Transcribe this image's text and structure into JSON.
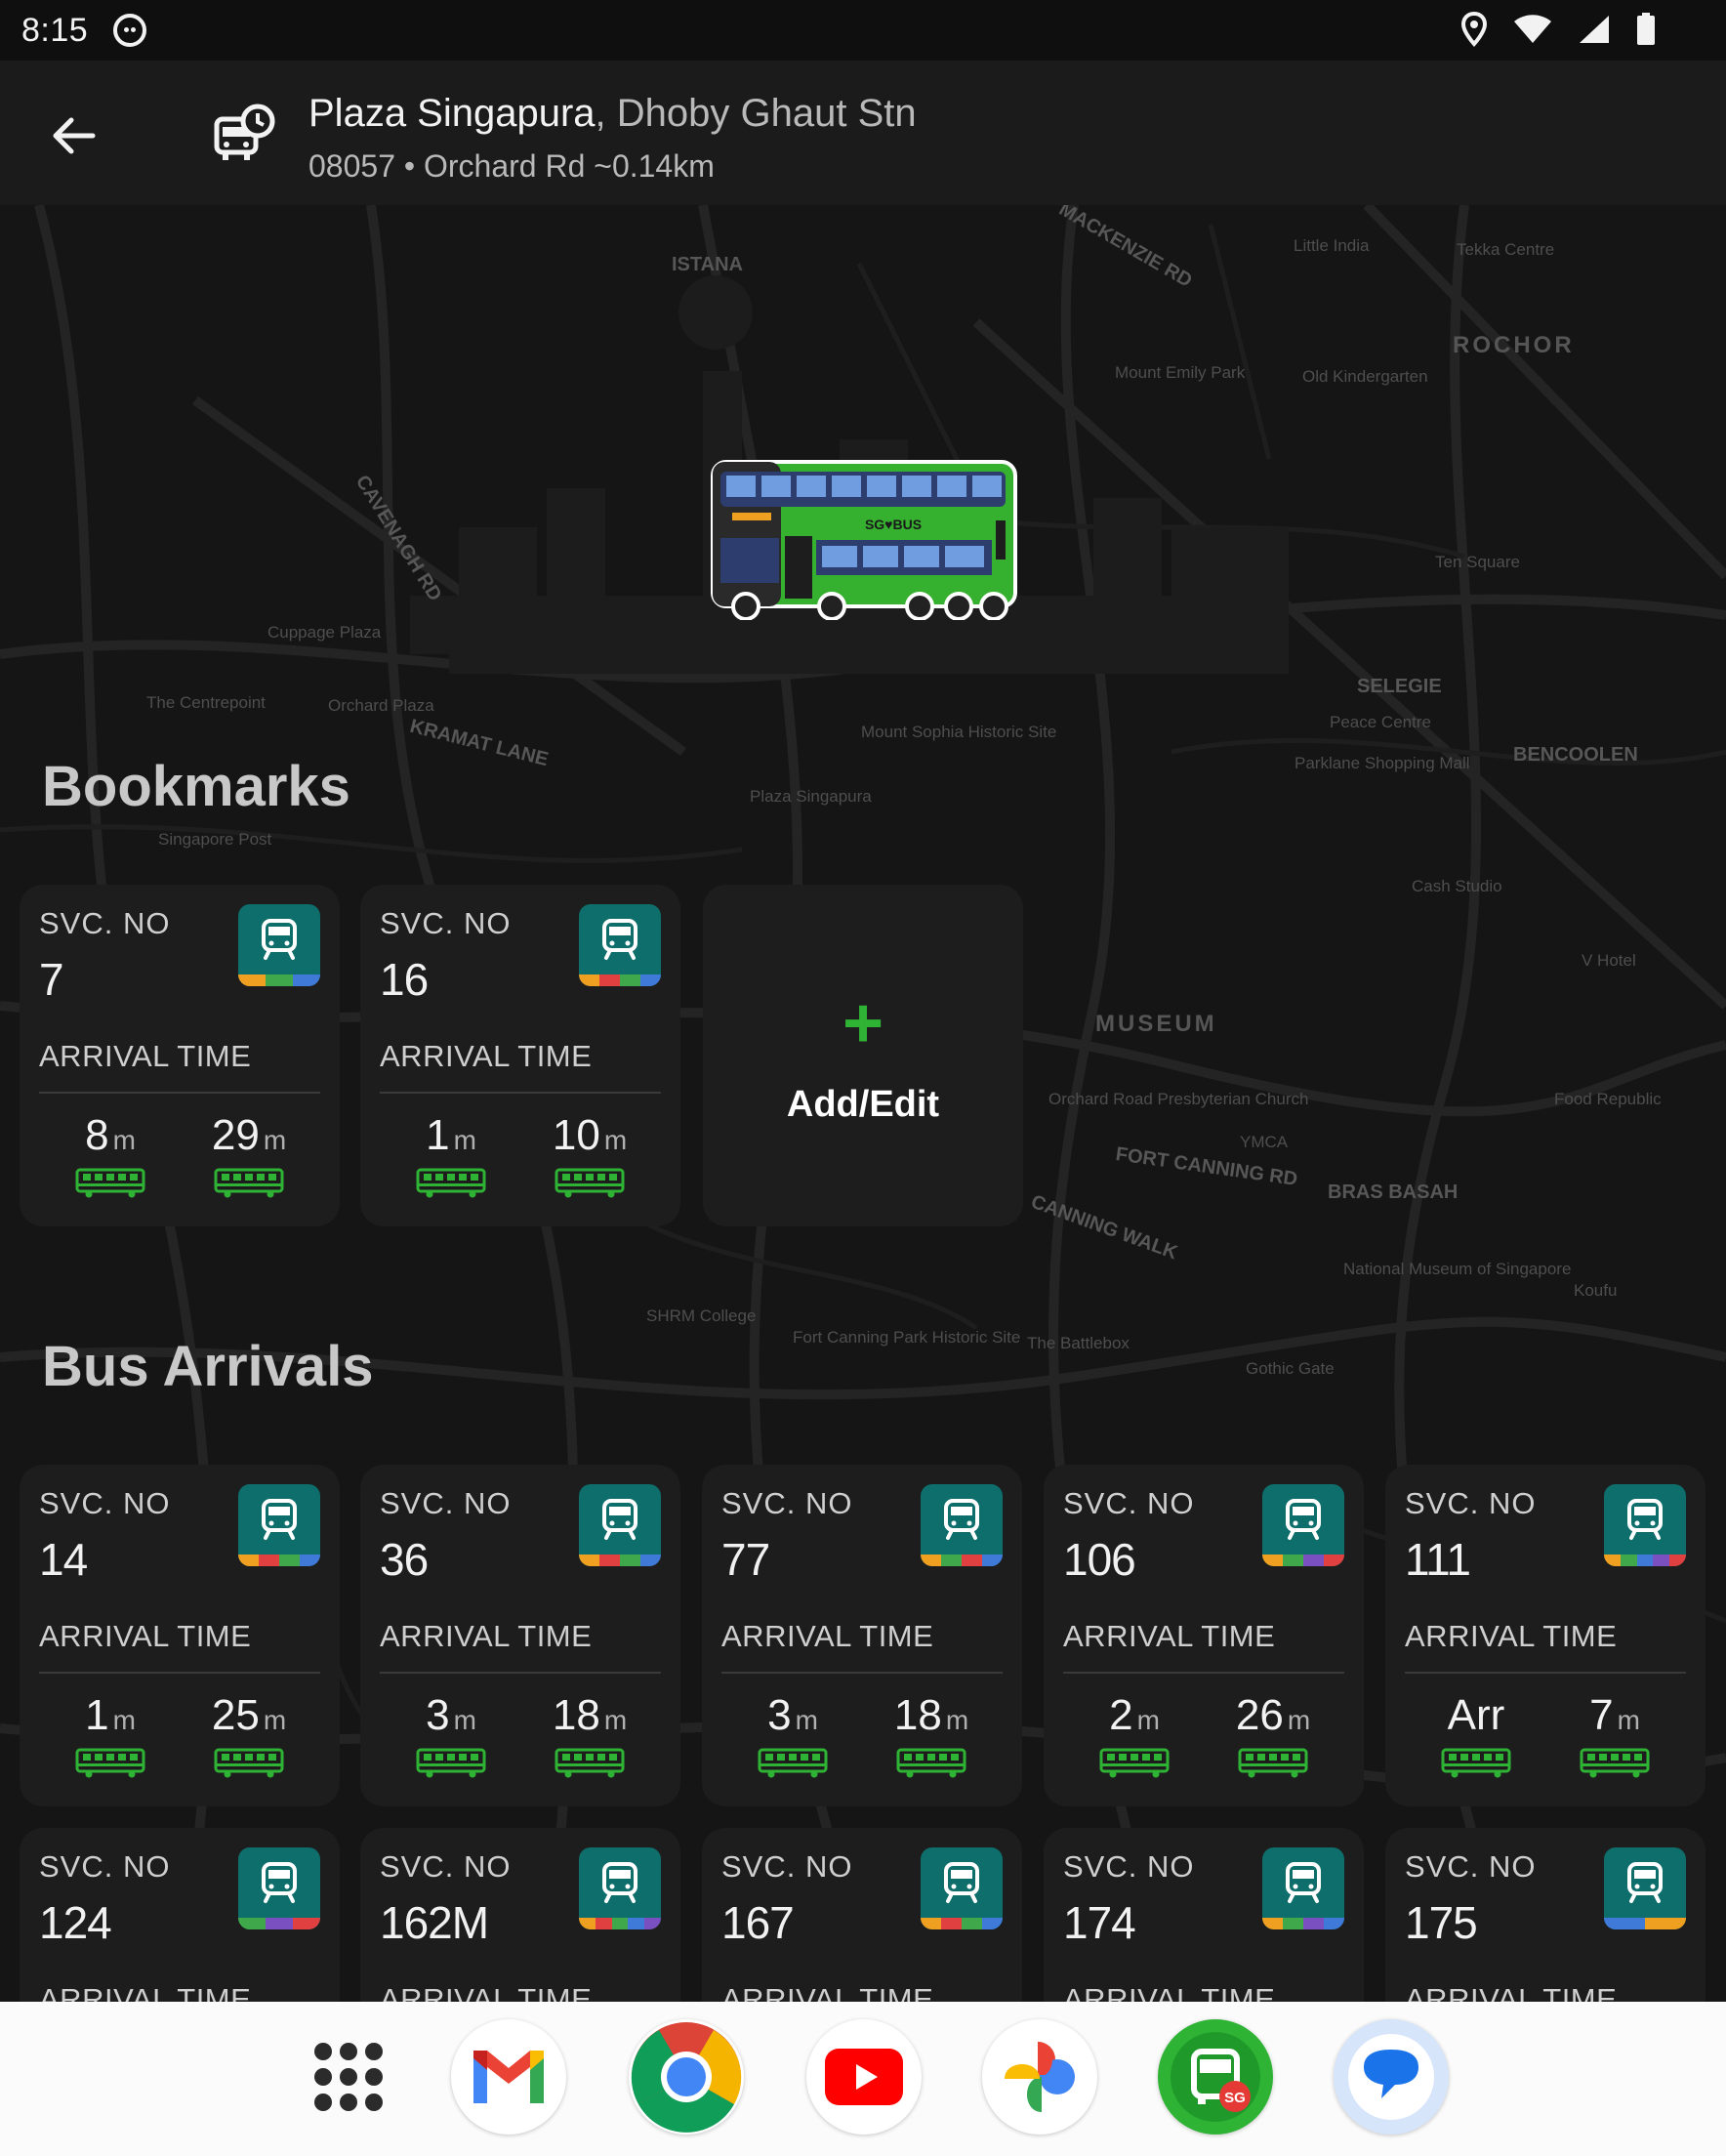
{
  "status_bar": {
    "time": "8:15"
  },
  "app_bar": {
    "stop_name": "Plaza Singapura",
    "separator": ",",
    "stop_area": "Dhoby Ghaut Stn",
    "stop_code": "08057",
    "bullet": "•",
    "road": "Orchard Rd",
    "distance": "~0.14km"
  },
  "hero": {
    "bus_brand": "SG♥BUS"
  },
  "map_labels": {
    "rochor": "ROCHOR",
    "museum": "MUSEUM",
    "selegie": "SELEGIE",
    "bencoolen": "BENCOOLEN",
    "bras_basah": "BRAS BASAH",
    "istana": "ISTANA",
    "little_india": "Little India",
    "tekka": "Tekka Centre",
    "mount_emily": "Mount Emily Park",
    "old_kindergarten": "Old Kindergarten",
    "plaza": "Plaza Singapura",
    "cuppage": "Cuppage Plaza",
    "centrepoint": "The Centrepoint",
    "orchard_plaza": "Orchard Plaza",
    "ten_square": "Ten Square",
    "mount_sophia": "Mount Sophia Historic Site",
    "fort_canning": "Fort Canning Park Historic Site",
    "battlebox": "The Battlebox",
    "gothic_gate": "Gothic Gate",
    "national_museum": "National Museum of Singapore",
    "food_republic": "Food Republic",
    "shrm": "SHRM College",
    "parklane": "Parklane Shopping Mall",
    "singapore_post": "Singapore Post",
    "ymca": "YMCA",
    "cash_studio": "Cash Studio",
    "v_hotel": "V Hotel",
    "peace_centre": "Peace Centre",
    "koufu": "Koufu",
    "orchard_rd_church": "Orchard Road Presbyterian Church",
    "fort_canning_rd": "FORT CANNING RD",
    "kramat_lane": "KRAMAT LANE",
    "mackenzie_rd": "MACKENZIE RD",
    "cavenagh_rd": "CAVENAGH RD",
    "canning_walk": "CANNING WALK"
  },
  "sections": {
    "bookmarks": "Bookmarks",
    "arrivals": "Bus Arrivals"
  },
  "labels": {
    "svc_no": "SVC. NO",
    "arrival_time": "ARRIVAL TIME",
    "minute_unit": "m"
  },
  "add_edit": {
    "plus": "+",
    "label": "Add/Edit"
  },
  "bookmarks": [
    {
      "svc": "7",
      "eta1": "8",
      "eta2": "29",
      "stripe": [
        "#f0a020",
        "#3fa84a",
        "#3f7ad8"
      ]
    },
    {
      "svc": "16",
      "eta1": "1",
      "eta2": "10",
      "stripe": [
        "#f0a020",
        "#e04040",
        "#3fa84a",
        "#3f7ad8"
      ]
    }
  ],
  "arrivals_row1": [
    {
      "svc": "14",
      "eta1": "1",
      "eta2": "25",
      "stripe": [
        "#f0a020",
        "#e04040",
        "#3fa84a",
        "#3f7ad8"
      ]
    },
    {
      "svc": "36",
      "eta1": "3",
      "eta2": "18",
      "stripe": [
        "#f0a020",
        "#e04040",
        "#3fa84a",
        "#3f7ad8"
      ]
    },
    {
      "svc": "77",
      "eta1": "3",
      "eta2": "18",
      "stripe": [
        "#f0a020",
        "#3fa84a",
        "#e04040",
        "#3f7ad8"
      ]
    },
    {
      "svc": "106",
      "eta1": "2",
      "eta2": "26",
      "stripe": [
        "#f0a020",
        "#3fa84a",
        "#7a4fc0",
        "#e04040"
      ]
    },
    {
      "svc": "111",
      "eta1": "Arr",
      "eta2": "7",
      "stripe": [
        "#f0a020",
        "#3fa84a",
        "#3f7ad8",
        "#7a4fc0",
        "#e04040"
      ]
    }
  ],
  "arrivals_row2": [
    {
      "svc": "124",
      "stripe": [
        "#3fa84a",
        "#7a4fc0",
        "#e04040"
      ]
    },
    {
      "svc": "162M",
      "stripe": [
        "#f0a020",
        "#e04040",
        "#3fa84a",
        "#3f7ad8",
        "#7a4fc0"
      ]
    },
    {
      "svc": "167",
      "stripe": [
        "#f0a020",
        "#e04040",
        "#3fa84a",
        "#3f7ad8"
      ]
    },
    {
      "svc": "174",
      "stripe": [
        "#f0a020",
        "#3fa84a",
        "#7a4fc0",
        "#3f7ad8"
      ]
    },
    {
      "svc": "175",
      "stripe": [
        "#3f7ad8",
        "#f0a020"
      ]
    }
  ],
  "dock": {
    "apps": [
      "app-drawer",
      "gmail",
      "chrome",
      "youtube",
      "photos",
      "sg-bus",
      "messages"
    ],
    "sg_badge": "SG"
  },
  "colors": {
    "accent_green": "#2fb335",
    "badge_teal": "#0e6e6b",
    "bus_green": "#2fb335"
  }
}
